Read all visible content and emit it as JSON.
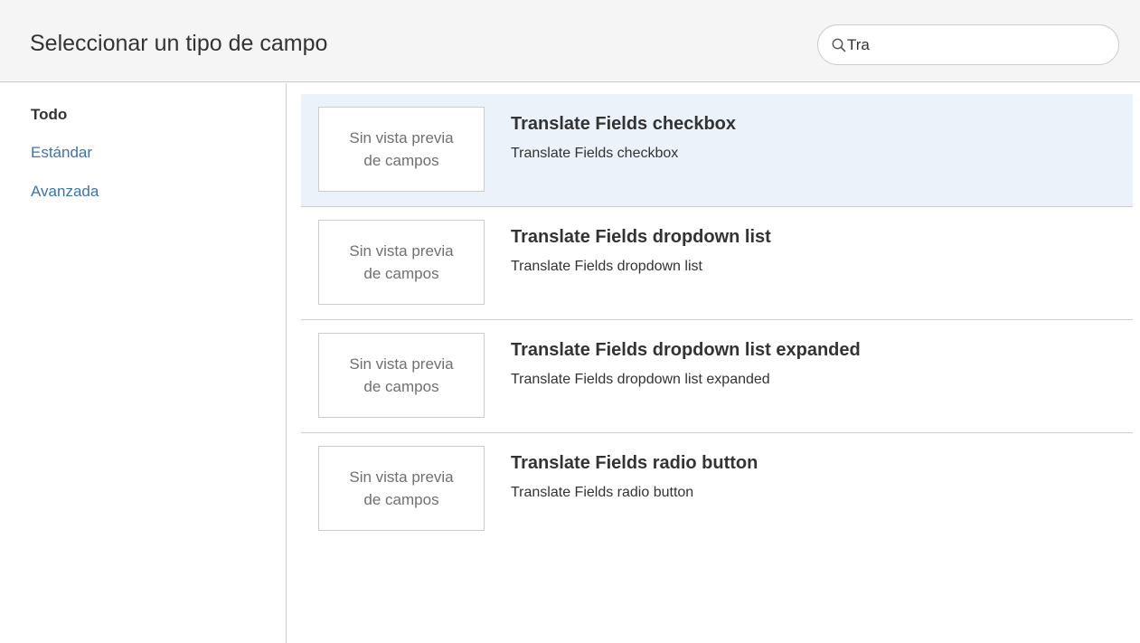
{
  "header": {
    "title": "Seleccionar un tipo de campo",
    "search": {
      "value": "Tra",
      "placeholder": "",
      "icon": "search-icon"
    }
  },
  "sidebar": {
    "items": [
      {
        "label": "Todo",
        "active": true
      },
      {
        "label": "Estándar",
        "active": false
      },
      {
        "label": "Avanzada",
        "active": false
      }
    ]
  },
  "results": [
    {
      "preview_line1": "Sin vista previa",
      "preview_line2": "de campos",
      "title": "Translate Fields checkbox",
      "description": "Translate Fields checkbox",
      "selected": true
    },
    {
      "preview_line1": "Sin vista previa",
      "preview_line2": "de campos",
      "title": "Translate Fields dropdown list",
      "description": "Translate Fields dropdown list",
      "selected": false
    },
    {
      "preview_line1": "Sin vista previa",
      "preview_line2": "de campos",
      "title": "Translate Fields dropdown list expanded",
      "description": "Translate Fields dropdown list expanded",
      "selected": false
    },
    {
      "preview_line1": "Sin vista previa",
      "preview_line2": "de campos",
      "title": "Translate Fields radio button",
      "description": "Translate Fields radio button",
      "selected": false
    }
  ],
  "colors": {
    "header_bg": "#f5f5f5",
    "selected_row_bg": "#ebf2f9",
    "link": "#3b73af",
    "border": "#cccccc",
    "text": "#333333",
    "muted_text": "#707070"
  }
}
